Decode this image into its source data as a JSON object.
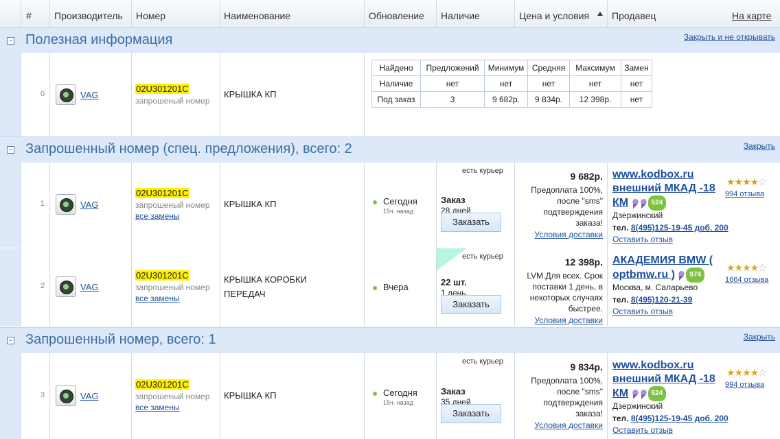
{
  "header": {
    "col_num": "#",
    "col_maker": "Производитель",
    "col_number": "Номер",
    "col_name": "Наименование",
    "col_update": "Обновление",
    "col_avail": "Наличие",
    "col_price": "Цена и условия",
    "col_seller": "Продавец",
    "map_link": "На карте"
  },
  "sections": [
    {
      "title": "Полезная информация",
      "action": "Закрыть и не открывать"
    },
    {
      "title": "Запрошенный номер (спец. предложения), всего: 2",
      "action": "Закрыть"
    },
    {
      "title": "Запрошенный номер, всего: 1",
      "action": "Закрыть"
    }
  ],
  "info_row": {
    "num": "0",
    "brand": "VAG",
    "part": "02U301201C",
    "part_sub": "запрошеный номер",
    "name": "КРЫШКА КП",
    "stats": {
      "headers": [
        "Найдено",
        "Предложений",
        "Минимум",
        "Средняя",
        "Максимум",
        "Замен"
      ],
      "rows": [
        [
          "Наличие",
          "нет",
          "нет",
          "нет",
          "нет",
          "нет"
        ],
        [
          "Под заказ",
          "3",
          "9 682р.",
          "9 834р.",
          "12 398р.",
          "нет"
        ]
      ]
    }
  },
  "rows": [
    {
      "num": "1",
      "brand": "VAG",
      "part": "02U301201C",
      "part_sub": "запрошеный номер",
      "replacements": "все замены",
      "name": "КРЫШКА КП",
      "name2": "",
      "update": "Сегодня",
      "update_sub": "15ч. назад",
      "courier": "есть курьер",
      "avail_bold": "Заказ",
      "avail": "28 дней",
      "order_btn": "Заказать",
      "price": "9 682р.",
      "cond": [
        "Предоплата 100%,",
        "после \"sms\"",
        "подтверждения",
        "заказа!"
      ],
      "delivery": "Условия доставки",
      "seller1": "www.kodbox.ru",
      "seller2": "внешний МКАД -18",
      "seller3": "КМ",
      "badge": "524",
      "city": "Дзержинский",
      "tel_label": "тел.",
      "tel": "8(495)125-19-45 доб. 200",
      "review": "Оставить отзыв",
      "reviews": "994 отзыва",
      "stars": 4
    },
    {
      "num": "2",
      "brand": "VAG",
      "part": "02U301201C",
      "part_sub": "запрошеный номер",
      "replacements": "все замены",
      "name": "КРЫШКА КОРОБКИ",
      "name2": "ПЕРЕДАЧ",
      "update": "Вчера",
      "update_sub": "",
      "courier": "есть курьер",
      "avail_bold": "22 шт.",
      "avail": "1 день.",
      "order_btn": "Заказать",
      "price": "12 398р.",
      "cond": [
        "LVM.Для всех. Срок",
        "поставки 1 день, в",
        "некоторых случаях",
        "быстрее."
      ],
      "delivery": "Условия доставки",
      "seller1": "АКАДЕМИЯ BMW (",
      "seller2": "optbmw.ru )",
      "seller3": "",
      "badge": "974",
      "city": "Москва, м. Саларьево",
      "tel_label": "тел.",
      "tel": "8(495)120-21-39",
      "review": "Оставить отзыв",
      "reviews": "1664 отзыва",
      "stars": 4
    },
    {
      "num": "3",
      "brand": "VAG",
      "part": "02U301201C",
      "part_sub": "запрошеный номер",
      "replacements": "все замены",
      "name": "КРЫШКА КП",
      "name2": "",
      "update": "Сегодня",
      "update_sub": "15ч. назад",
      "courier": "есть курьер",
      "avail_bold": "Заказ",
      "avail": "35 дней",
      "order_btn": "Заказать",
      "price": "9 834р.",
      "cond": [
        "Предоплата 100%,",
        "после \"sms\"",
        "подтверждения",
        "заказа!"
      ],
      "delivery": "Условия доставки",
      "seller1": "www.kodbox.ru",
      "seller2": "внешний МКАД -18",
      "seller3": "КМ",
      "badge": "524",
      "city": "Дзержинский",
      "tel_label": "тел.",
      "tel": "8(495)125-19-45 доб. 200",
      "review": "Оставить отзыв",
      "reviews": "994 отзыва",
      "stars": 4
    }
  ],
  "colors": {
    "section_bg": "#dde9f8",
    "section_title": "#3a6ea5",
    "highlight": "#ffef00",
    "link": "#1f4f9e",
    "badge": "#7dc242"
  },
  "icons": {
    "sort": "sort-asc-triangle-icon",
    "toggle": "collapse-minus-icon",
    "logo": "skoda-logo-icon",
    "dot": "status-dot-icon",
    "star": "star-icon",
    "ribbon": "award-ribbon-icon"
  }
}
